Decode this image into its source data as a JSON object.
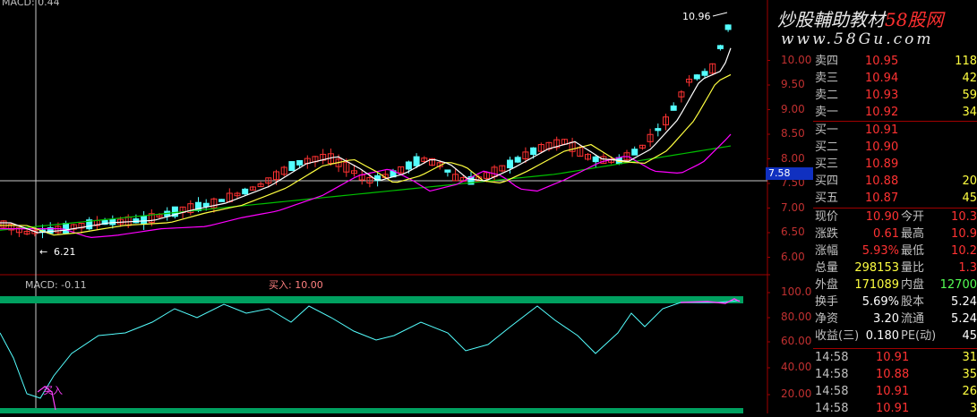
{
  "chart_header": {
    "macd_top": "MACD: 0.44",
    "macd_bottom": "MACD: -0.11",
    "buy_signal": "买入: 10.00",
    "buy_marker": "买入"
  },
  "chart_labels": {
    "high_price": "10.96",
    "low_price": "6.21",
    "current_price": "7.58",
    "low_arrow": "←"
  },
  "watermark": {
    "line1_a": "炒股輔助教材",
    "line1_b": "58股网",
    "line2": "www.58Gu.com"
  },
  "price_axis": [
    "10.00",
    "9.50",
    "9.00",
    "8.50",
    "8.00",
    "7.50",
    "7.00",
    "6.50",
    "6.00"
  ],
  "indicator_axis": [
    "100.0",
    "80.00",
    "60.00",
    "40.00",
    "20.00"
  ],
  "order_book": {
    "asks": [
      {
        "label": "卖四",
        "price": "10.95",
        "vol": "118"
      },
      {
        "label": "卖三",
        "price": "10.94",
        "vol": "42"
      },
      {
        "label": "卖二",
        "price": "10.93",
        "vol": "59"
      },
      {
        "label": "卖一",
        "price": "10.92",
        "vol": "34"
      }
    ],
    "bids": [
      {
        "label": "买一",
        "price": "10.91",
        "vol": ""
      },
      {
        "label": "买二",
        "price": "10.90",
        "vol": ""
      },
      {
        "label": "买三",
        "price": "10.89",
        "vol": ""
      },
      {
        "label": "买四",
        "price": "10.88",
        "vol": "20"
      },
      {
        "label": "买五",
        "price": "10.87",
        "vol": "45"
      }
    ]
  },
  "quote": [
    {
      "l1": "现价",
      "v1": "10.90",
      "l2": "今开",
      "v2": "10.3"
    },
    {
      "l1": "涨跌",
      "v1": "0.61",
      "l2": "最高",
      "v2": "10.9"
    },
    {
      "l1": "涨幅",
      "v1": "5.93%",
      "l2": "最低",
      "v2": "10.2"
    },
    {
      "l1": "总量",
      "v1": "298153",
      "l2": "量比",
      "v2": "1.3"
    },
    {
      "l1": "外盘",
      "v1": "171089",
      "l2": "内盘",
      "v2": "12700"
    },
    {
      "l1": "换手",
      "v1": "5.69%",
      "l2": "股本",
      "v2": "5.24"
    },
    {
      "l1": "净资",
      "v1": "3.20",
      "l2": "流通",
      "v2": "5.24"
    },
    {
      "l1": "收益(三)",
      "v1": "0.180",
      "l2": "PE(动)",
      "v2": "45"
    }
  ],
  "ticks": [
    {
      "time": "14:58",
      "price": "10.91",
      "vol": "31"
    },
    {
      "time": "14:58",
      "price": "10.88",
      "vol": "35"
    },
    {
      "time": "14:58",
      "price": "10.91",
      "vol": "26"
    },
    {
      "time": "14:58",
      "price": "10.91",
      "vol": "3"
    }
  ],
  "colors": {
    "up": "#ff3232",
    "down": "#54ffff",
    "ma5": "#ffffff",
    "ma10": "#ffff00",
    "ma20": "#ff00ff",
    "ma60": "#00c000",
    "indicator": "#54ffff"
  }
}
